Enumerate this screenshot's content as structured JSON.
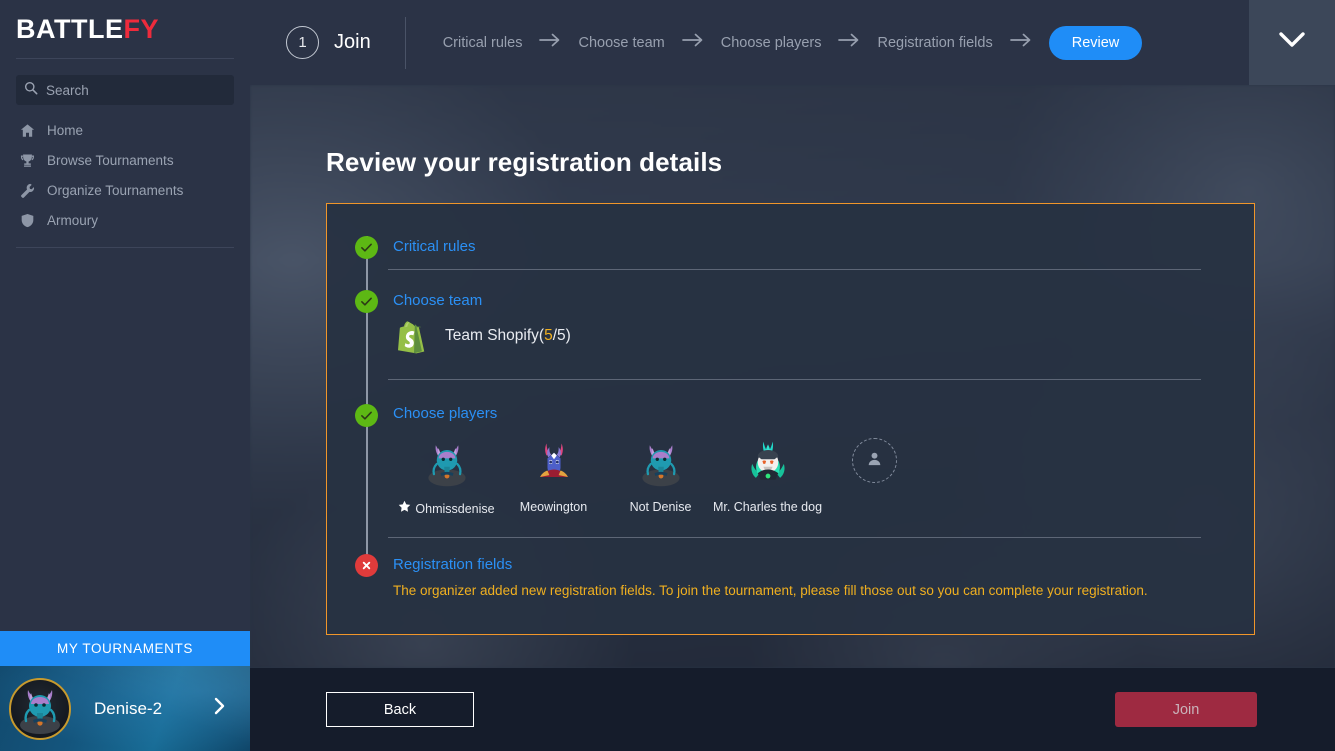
{
  "brand": {
    "name_main": "BATTLE",
    "name_accent": "FY",
    "accent_color": "#ee2b3c"
  },
  "search": {
    "placeholder": "Search",
    "value": "",
    "icon": "search-icon"
  },
  "sidebar": {
    "items": [
      {
        "label": "Home",
        "icon": "home-icon"
      },
      {
        "label": "Browse Tournaments",
        "icon": "trophy-icon"
      },
      {
        "label": "Organize Tournaments",
        "icon": "wrench-icon"
      },
      {
        "label": "Armoury",
        "icon": "shield-icon"
      }
    ],
    "my_tournaments_label": "MY TOURNAMENTS",
    "profile": {
      "name": "Denise-2",
      "chevron_icon": "chevron-right-icon",
      "avatar_icon": "user-avatar"
    }
  },
  "header": {
    "step_number": "1",
    "step_title": "Join",
    "collapse_icon": "chevron-down-icon",
    "breadcrumbs": [
      {
        "label": "Critical rules",
        "active": false
      },
      {
        "label": "Choose team",
        "active": false
      },
      {
        "label": "Choose players",
        "active": false
      },
      {
        "label": "Registration fields",
        "active": false
      },
      {
        "label": "Review",
        "active": true
      }
    ],
    "arrow_icon": "arrow-right-icon",
    "active_color": "#1f8df7"
  },
  "main": {
    "page_title": "Review your registration details",
    "card_border_color": "#f0962a",
    "sections": [
      {
        "title": "Critical rules",
        "status": "complete",
        "status_icon": "check-circle-icon"
      },
      {
        "title": "Choose team",
        "status": "complete",
        "status_icon": "check-circle-icon"
      },
      {
        "title": "Choose players",
        "status": "complete",
        "status_icon": "check-circle-icon"
      },
      {
        "title": "Registration fields",
        "status": "error",
        "status_icon": "x-circle-icon"
      }
    ],
    "team": {
      "name": "Team Shopify",
      "count_prefix": "(",
      "count_used": "5",
      "count_sep": "/",
      "count_total": "5",
      "count_suffix": ")",
      "logo_icon": "shopify-logo"
    },
    "players": [
      {
        "name": "Ohmissdenise",
        "captain": true,
        "captain_icon": "star-icon"
      },
      {
        "name": "Meowington",
        "captain": false
      },
      {
        "name": "Not Denise",
        "captain": false
      },
      {
        "name": "Mr. Charles the dog",
        "captain": false
      }
    ],
    "empty_slot": {
      "icon": "person-add-icon"
    },
    "registration_message": "The organizer added new registration fields. To join the tournament, please fill those out so you can complete your registration.",
    "warning_color": "#f0b020"
  },
  "footer": {
    "back_label": "Back",
    "join_label": "Join",
    "join_disabled": true
  }
}
